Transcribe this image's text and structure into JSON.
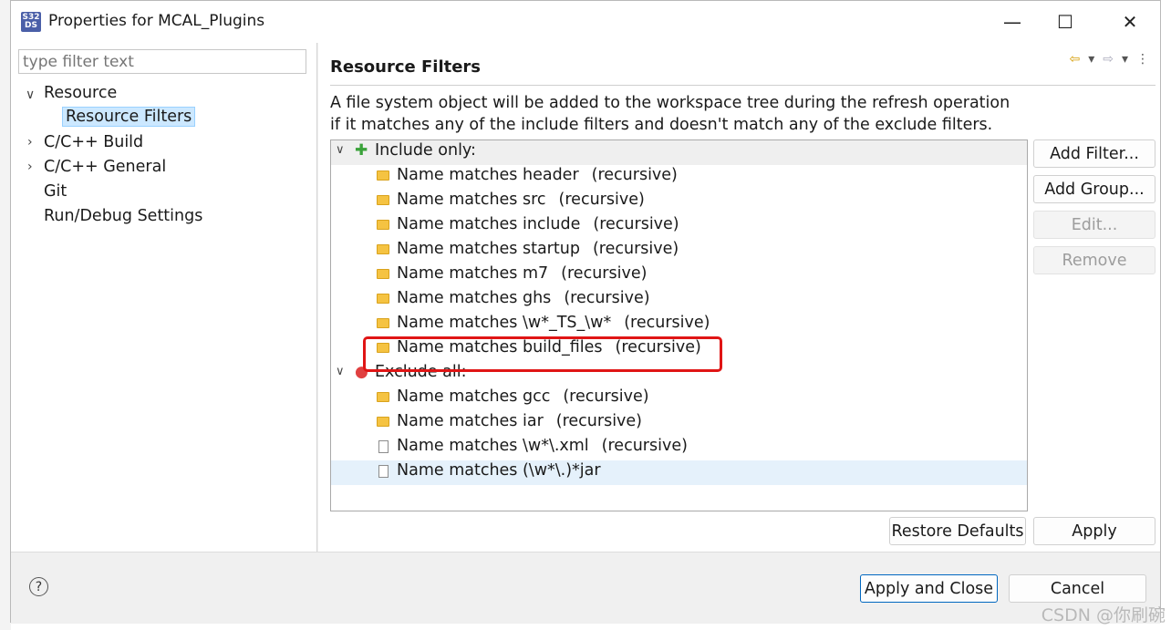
{
  "window": {
    "title": "Properties for MCAL_Plugins",
    "app_icon_text": "S32\nDS",
    "minimize_glyph": "—",
    "maximize_glyph": "☐",
    "close_glyph": "✕"
  },
  "sidebar": {
    "filter_placeholder": "type filter text",
    "items": [
      {
        "label": "Resource",
        "expanded": true
      },
      {
        "label": "Resource Filters",
        "selected": true
      },
      {
        "label": "C/C++ Build",
        "expanded": false
      },
      {
        "label": "C/C++ General",
        "expanded": false
      },
      {
        "label": "Git"
      },
      {
        "label": "Run/Debug Settings"
      }
    ]
  },
  "page": {
    "title": "Resource Filters",
    "description_line1": "A file system object will be added to the workspace tree during the refresh operation",
    "description_line2": "if it matches any of the include filters and doesn't match any of the exclude filters."
  },
  "filters": {
    "include_group": "Include only:",
    "include_items": [
      {
        "text": "Name matches header",
        "mode": "(recursive)"
      },
      {
        "text": "Name matches src",
        "mode": "(recursive)"
      },
      {
        "text": "Name matches include",
        "mode": "(recursive)"
      },
      {
        "text": "Name matches startup",
        "mode": "(recursive)"
      },
      {
        "text": "Name matches m7",
        "mode": "(recursive)"
      },
      {
        "text": "Name matches ghs",
        "mode": "(recursive)"
      },
      {
        "text": "Name matches \\w*_TS_\\w*",
        "mode": "(recursive)"
      },
      {
        "text": "Name matches build_files",
        "mode": "(recursive)"
      }
    ],
    "exclude_group": "Exclude all:",
    "exclude_items": [
      {
        "text": "Name matches gcc",
        "mode": "(recursive)",
        "type": "folder"
      },
      {
        "text": "Name matches iar",
        "mode": "(recursive)",
        "type": "folder"
      },
      {
        "text": "Name matches \\w*\\.xml",
        "mode": "(recursive)",
        "type": "file"
      },
      {
        "text": "Name matches (\\w*\\.)*jar",
        "mode": "",
        "type": "file"
      }
    ]
  },
  "buttons": {
    "add_filter": "Add Filter...",
    "add_group": "Add Group...",
    "edit": "Edit...",
    "remove": "Remove",
    "restore_defaults": "Restore Defaults",
    "apply": "Apply",
    "apply_and_close": "Apply and Close",
    "cancel": "Cancel"
  },
  "watermark": "CSDN @你刷碗",
  "colors": {
    "accent": "#0067c0",
    "selection": "#cce8ff",
    "highlight_box": "#e01515"
  }
}
